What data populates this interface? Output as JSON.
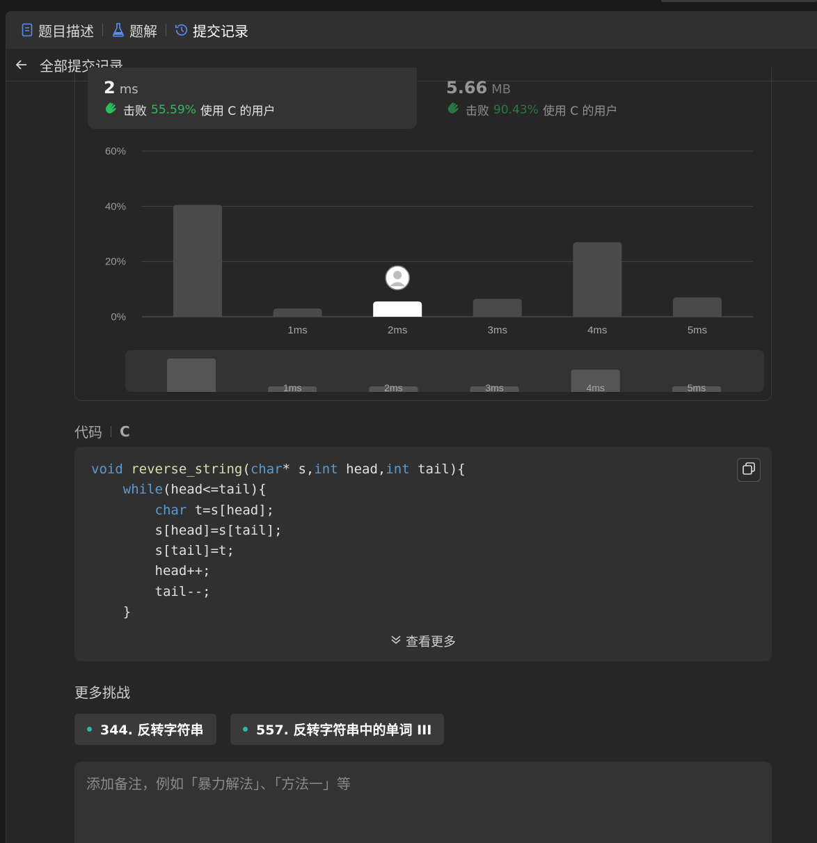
{
  "tabs": {
    "description": "题目描述",
    "solutions": "题解",
    "submissions": "提交记录"
  },
  "subbar": {
    "back_label": "全部提交记录"
  },
  "runtime": {
    "value": "2",
    "unit": "ms",
    "beat_prefix": "击败",
    "beat_pct": "55.59%",
    "beat_suffix": "使用 C 的用户"
  },
  "memory": {
    "value": "5.66",
    "unit": "MB",
    "beat_prefix": "击败",
    "beat_pct": "90.43%",
    "beat_suffix": "使用 C 的用户"
  },
  "colors": {
    "accent_green": "#2cbb5d",
    "bar": "#4a4a4a",
    "bar_highlight": "#ffffff",
    "chip_dot": "#2db8a3"
  },
  "chart_data": {
    "type": "bar",
    "categories": [
      "",
      "1ms",
      "2ms",
      "3ms",
      "4ms",
      "5ms"
    ],
    "values": [
      40.5,
      3,
      5.5,
      6.5,
      27,
      7
    ],
    "highlight_index": 2,
    "yticks": [
      "0%",
      "20%",
      "40%",
      "60%"
    ],
    "ylim": [
      0,
      60
    ],
    "grid": true,
    "navigator_values": [
      40.5,
      3,
      5.5,
      6.5,
      27,
      7
    ]
  },
  "code": {
    "label": "代码",
    "lang": "C",
    "lines": [
      "void reverse_string(char* s,int head,int tail){",
      "    while(head<=tail){",
      "        char t=s[head];",
      "        s[head]=s[tail];",
      "        s[tail]=t;",
      "        head++;",
      "        tail--;",
      "    }"
    ],
    "more_label": "查看更多"
  },
  "challenges": {
    "title": "更多挑战",
    "items": [
      "344. 反转字符串",
      "557. 反转字符串中的单词 III"
    ]
  },
  "note": {
    "placeholder": "添加备注，例如「暴力解法」、「方法一」等"
  }
}
